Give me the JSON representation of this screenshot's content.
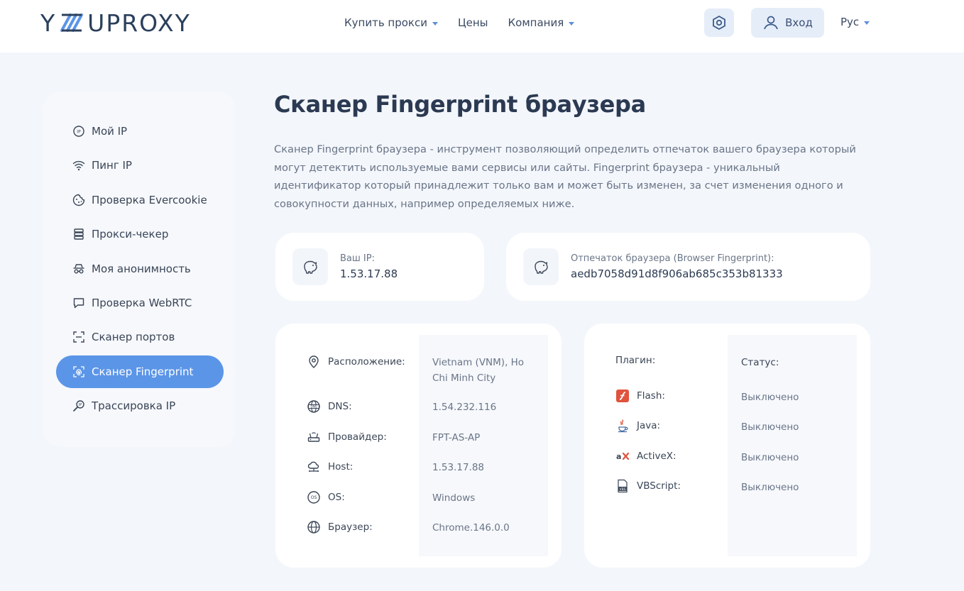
{
  "brand": {
    "logo_left": "Y",
    "logo_right": "UPROXY"
  },
  "nav": {
    "items": [
      {
        "label": "Купить прокси",
        "dropdown": true
      },
      {
        "label": "Цены",
        "dropdown": false
      },
      {
        "label": "Компания",
        "dropdown": true
      }
    ],
    "login_label": "Вход",
    "lang_label": "Рус"
  },
  "sidebar": {
    "items": [
      {
        "label": "Мой IP",
        "icon": "ip-pin-icon",
        "active": false
      },
      {
        "label": "Пинг IP",
        "icon": "wifi-icon",
        "active": false
      },
      {
        "label": "Проверка Evercookie",
        "icon": "cookie-icon",
        "active": false
      },
      {
        "label": "Прокси-чекер",
        "icon": "server-icon",
        "active": false
      },
      {
        "label": "Моя анонимность",
        "icon": "incognito-icon",
        "active": false
      },
      {
        "label": "Проверка WebRTC",
        "icon": "chat-icon",
        "active": false
      },
      {
        "label": "Сканер портов",
        "icon": "scan-icon",
        "active": false
      },
      {
        "label": "Сканер Fingerprint",
        "icon": "fingerprint-icon",
        "active": true
      },
      {
        "label": "Трассировка IP",
        "icon": "trace-icon",
        "active": false
      }
    ]
  },
  "main": {
    "title": "Сканер Fingerprint браузера",
    "description": "Сканер Fingerprint браузера - инструмент позволяющий определить отпечаток вашего браузера который могут детектить используемые вами сервисы или сайты. Fingerprint браузера - уникальный идентификатор который принадлежит только вам и может быть изменен, за счет изменения одного и совокупности данных, например определяемых ниже.",
    "ip_card": {
      "label": "Ваш IP:",
      "value": "1.53.17.88"
    },
    "fp_card": {
      "label": "Отпечаток браузера (Browser Fingerprint):",
      "value": "aedb7058d91d8f906ab685c353b81333"
    }
  },
  "info": {
    "rows": [
      {
        "label": "Расположение:",
        "value": "Vietnam (VNM), Ho Chi Minh City",
        "icon": "location-pin-icon"
      },
      {
        "label": "DNS:",
        "value": "1.54.232.116",
        "icon": "dns-globe-icon"
      },
      {
        "label": "Провайдер:",
        "value": "FPT-AS-AP",
        "icon": "router-icon"
      },
      {
        "label": "Host:",
        "value": "1.53.17.88",
        "icon": "cloud-network-icon"
      },
      {
        "label": "OS:",
        "value": "Windows",
        "icon": "os-icon"
      },
      {
        "label": "Браузер:",
        "value": "Chrome.146.0.0",
        "icon": "globe-icon"
      }
    ]
  },
  "plugins": {
    "header_plugin": "Плагин:",
    "header_status": "Статус:",
    "rows": [
      {
        "label": "Flash:",
        "status": "Выключено",
        "icon": "flash-icon"
      },
      {
        "label": "Java:",
        "status": "Выключено",
        "icon": "java-icon"
      },
      {
        "label": "ActiveX:",
        "status": "Выключено",
        "icon": "activex-icon"
      },
      {
        "label": "VBScript:",
        "status": "Выключено",
        "icon": "vbscript-icon"
      }
    ]
  },
  "colors": {
    "accent": "#5b95e8",
    "title": "#2b3a52",
    "muted": "#6a7587",
    "page_bg": "#f3f6fb"
  }
}
